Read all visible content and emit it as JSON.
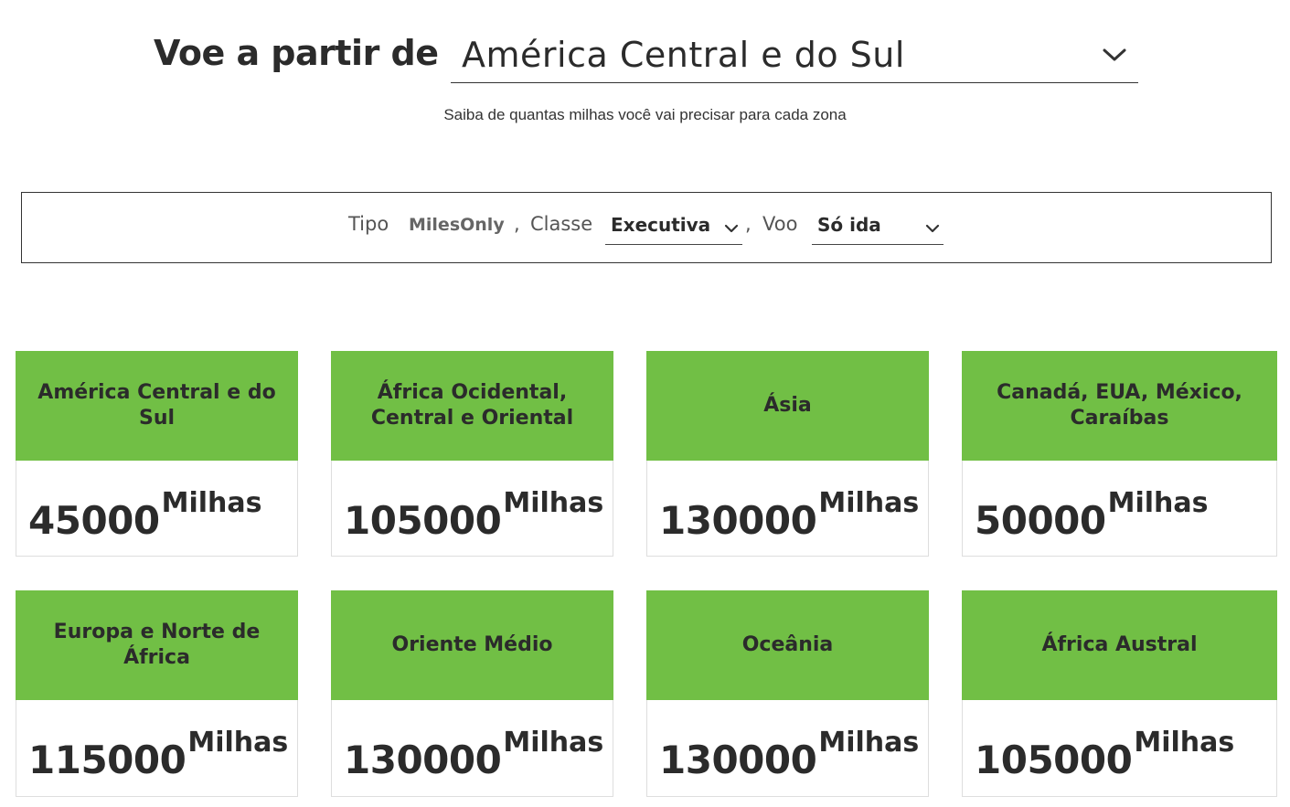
{
  "header": {
    "title": "Voe a partir de",
    "origin": "América Central e do Sul",
    "origin_icon": "chevron-down-icon",
    "subtitle": "Saiba de quantas milhas você vai precisar para cada zona"
  },
  "filters": {
    "type_label": "Tipo",
    "type_value": "MilesOnly",
    "class_label": "Classe",
    "class_value": "Executiva",
    "flight_label": "Voo",
    "flight_value": "Só ida",
    "separator": ","
  },
  "colors": {
    "accent": "#71bf45",
    "text": "#2b2b2b"
  },
  "zones": [
    {
      "name": "América Central e do Sul",
      "miles": "45000",
      "unit": "Milhas"
    },
    {
      "name": "África Ocidental, Central e Oriental",
      "miles": "105000",
      "unit": "Milhas"
    },
    {
      "name": "Ásia",
      "miles": "130000",
      "unit": "Milhas"
    },
    {
      "name": "Canadá, EUA, México, Caraíbas",
      "miles": "50000",
      "unit": "Milhas"
    },
    {
      "name": "Europa e Norte de África",
      "miles": "115000",
      "unit": "Milhas"
    },
    {
      "name": "Oriente Médio",
      "miles": "130000",
      "unit": "Milhas"
    },
    {
      "name": "Oceânia",
      "miles": "130000",
      "unit": "Milhas"
    },
    {
      "name": "África Austral",
      "miles": "105000",
      "unit": "Milhas"
    }
  ]
}
